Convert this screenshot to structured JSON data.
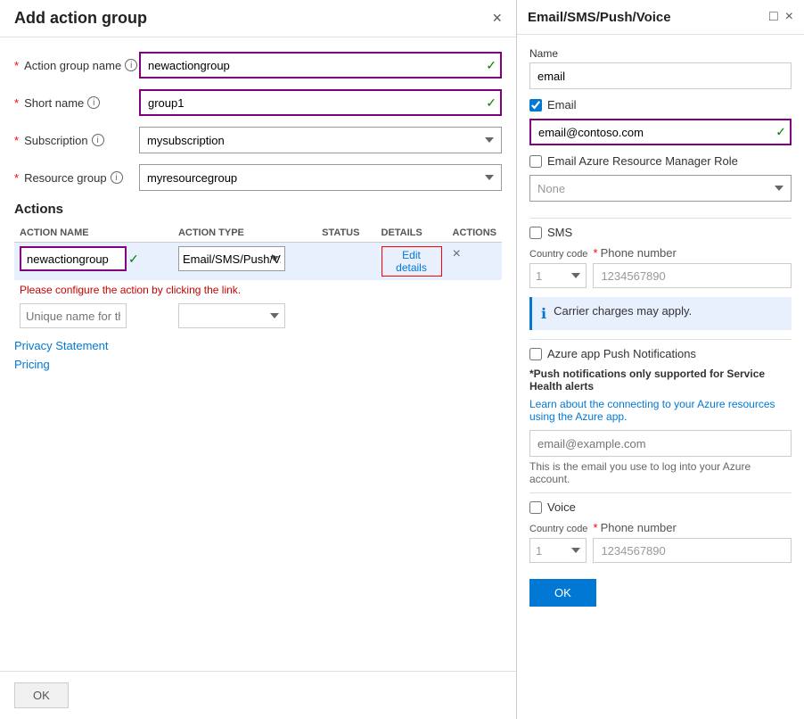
{
  "left_panel": {
    "title": "Add action group",
    "close_label": "×",
    "fields": {
      "action_group_name_label": "Action group name",
      "action_group_name_value": "newactiongroup",
      "short_name_label": "Short name",
      "short_name_value": "group1",
      "subscription_label": "Subscription",
      "subscription_value": "mysubscription",
      "resource_group_label": "Resource group",
      "resource_group_value": "myresourcegroup"
    },
    "actions_section": {
      "title": "Actions",
      "columns": {
        "action_name": "ACTION NAME",
        "action_type": "ACTION TYPE",
        "status": "STATUS",
        "details": "DETAILS",
        "actions": "ACTIONS"
      },
      "rows": [
        {
          "name": "newactiongroup",
          "type": "Email/SMS/Push/V...",
          "status": "",
          "details": "Edit details",
          "remove": "×"
        }
      ],
      "error_text": "Please configure the action by clicking the link.",
      "new_row_placeholder": "Unique name for the act...",
      "new_row_type_placeholder": ""
    },
    "privacy_statement": "Privacy Statement",
    "pricing": "Pricing",
    "ok_label": "OK"
  },
  "right_panel": {
    "title": "Email/SMS/Push/Voice",
    "maximize_label": "□",
    "close_label": "×",
    "name_label": "Name",
    "name_value": "email",
    "email_checkbox_label": "Email",
    "email_checked": true,
    "email_value": "email@contoso.com",
    "email_azure_rm_label": "Email Azure Resource Manager Role",
    "email_azure_rm_checked": false,
    "azure_rm_select_value": "None",
    "sms_label": "SMS",
    "sms_checked": false,
    "sms_country_code_label": "Country code",
    "sms_country_code_value": "1",
    "sms_phone_label": "Phone number",
    "sms_phone_value": "1234567890",
    "carrier_charges": "Carrier charges may apply.",
    "azure_push_label": "Azure app Push Notifications",
    "azure_push_checked": false,
    "push_note": "*Push notifications only supported for Service Health alerts",
    "azure_link_text": "Learn about the connecting to your Azure resources using the Azure app.",
    "push_email_placeholder": "email@example.com",
    "push_email_hint": "This is the email you use to log into your Azure account.",
    "voice_label": "Voice",
    "voice_checked": false,
    "voice_country_code_label": "Country code",
    "voice_country_code_value": "1",
    "voice_phone_label": "Phone number",
    "voice_phone_value": "1234567890",
    "ok_label": "OK"
  }
}
